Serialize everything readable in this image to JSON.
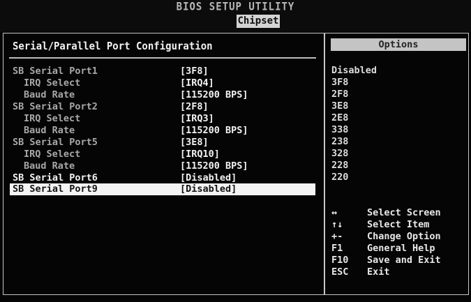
{
  "header": {
    "title": "BIOS SETUP UTILITY",
    "active_tab": "Chipset"
  },
  "section_title": "Serial/Parallel Port Configuration",
  "settings": [
    {
      "label": "SB Serial Port1",
      "value": "[3F8]"
    },
    {
      "label": "IRQ Select",
      "value": "[IRQ4]"
    },
    {
      "label": "Baud Rate",
      "value": "[115200 BPS]"
    },
    {
      "label": "SB Serial Port2",
      "value": "[2F8]"
    },
    {
      "label": "IRQ Select",
      "value": "[IRQ3]"
    },
    {
      "label": "Baud Rate",
      "value": "[115200 BPS]"
    },
    {
      "label": "SB Serial Port5",
      "value": "[3E8]"
    },
    {
      "label": "IRQ Select",
      "value": "[IRQ10]"
    },
    {
      "label": "Baud Rate",
      "value": "[115200 BPS]"
    },
    {
      "label": "SB Serial Port6",
      "value": "[Disabled]"
    },
    {
      "label": "SB Serial Port9",
      "value": "[Disabled]"
    }
  ],
  "options_panel": {
    "header": "Options",
    "items": [
      "Disabled",
      "3F8",
      "2F8",
      "3E8",
      "2E8",
      "338",
      "238",
      "328",
      "228",
      "220"
    ]
  },
  "help": [
    {
      "key": "↔",
      "description": "Select Screen"
    },
    {
      "key": "↑↓",
      "description": "Select Item"
    },
    {
      "key": "+-",
      "description": "Change Option"
    },
    {
      "key": "F1",
      "description": "General Help"
    },
    {
      "key": "F10",
      "description": "Save and Exit"
    },
    {
      "key": "ESC",
      "description": "Exit"
    }
  ],
  "colors": {
    "background": "#050505",
    "text": "#e8e8e8",
    "dim_label": "#a8a8a8",
    "selection": "#f4f4f4"
  }
}
